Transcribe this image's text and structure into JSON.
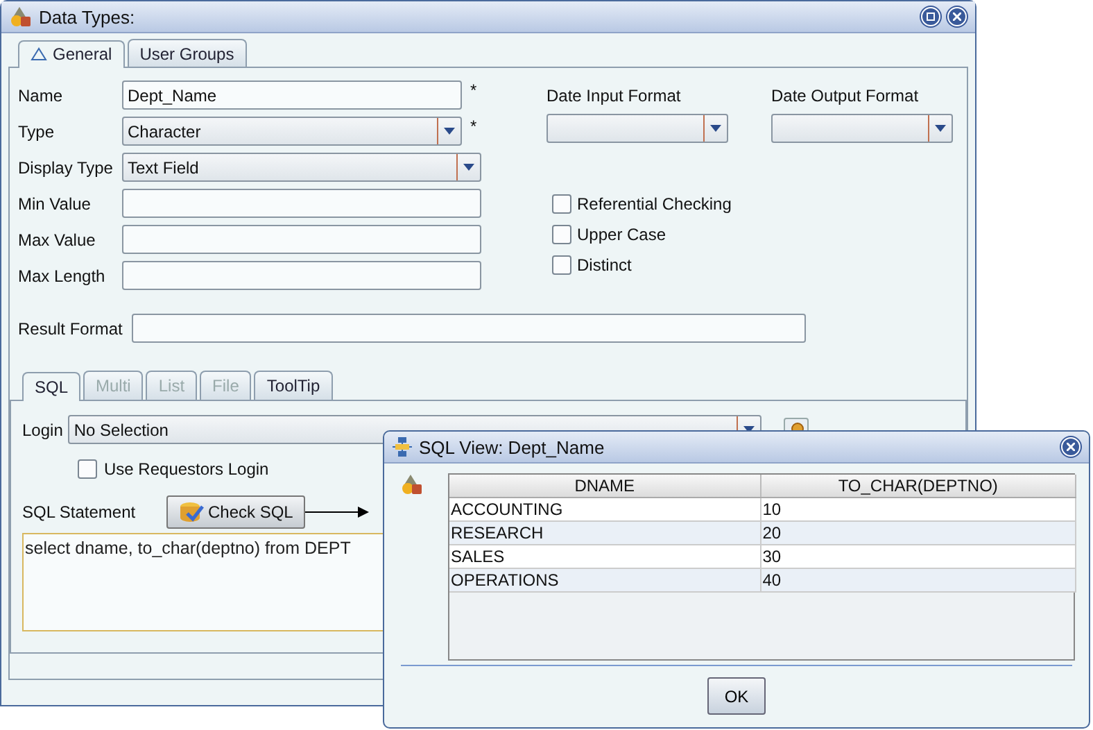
{
  "window": {
    "title": "Data Types:"
  },
  "tabs": [
    {
      "label": "General",
      "selected": true
    },
    {
      "label": "User Groups",
      "selected": false
    }
  ],
  "fields": [
    {
      "label": "Name",
      "kind": "text",
      "value": "Dept_Name",
      "marker": "*"
    },
    {
      "label": "Type",
      "kind": "combo",
      "value": "Character",
      "marker": "*"
    },
    {
      "label": "Display Type",
      "kind": "combo",
      "value": "Text Field"
    },
    {
      "label": "Min Value",
      "kind": "text"
    },
    {
      "label": "Max Value",
      "kind": "text"
    },
    {
      "label": "Max Length",
      "kind": "text"
    }
  ],
  "date_formats": [
    {
      "label": "Date Input Format"
    },
    {
      "label": "Date Output Format"
    }
  ],
  "options": [
    {
      "label": "Referential Checking",
      "checked": false
    },
    {
      "label": "Upper Case",
      "checked": false
    },
    {
      "label": "Distinct",
      "checked": false
    }
  ],
  "result_format": {
    "label": "Result Format"
  },
  "sub_tabs": [
    {
      "label": "SQL",
      "selected": true,
      "disabled": false
    },
    {
      "label": "Multi",
      "selected": false,
      "disabled": true
    },
    {
      "label": "List",
      "selected": false,
      "disabled": true
    },
    {
      "label": "File",
      "selected": false,
      "disabled": true
    },
    {
      "label": "ToolTip",
      "selected": false,
      "disabled": false
    }
  ],
  "sql": {
    "login_label": "Login",
    "login_value": "No Selection",
    "use_requestors_login": {
      "label": "Use Requestors Login",
      "checked": false
    },
    "statement_label": "SQL Statement",
    "check_button": "Check SQL",
    "statement": "select dname, to_char(deptno) from DEPT"
  },
  "dialog": {
    "title": "SQL View: Dept_Name",
    "columns": [
      "DNAME",
      "TO_CHAR(DEPTNO)"
    ],
    "rows": [
      [
        "ACCOUNTING",
        "10"
      ],
      [
        "RESEARCH",
        "20"
      ],
      [
        "SALES",
        "30"
      ],
      [
        "OPERATIONS",
        "40"
      ]
    ],
    "buttons": [
      "OK"
    ]
  }
}
